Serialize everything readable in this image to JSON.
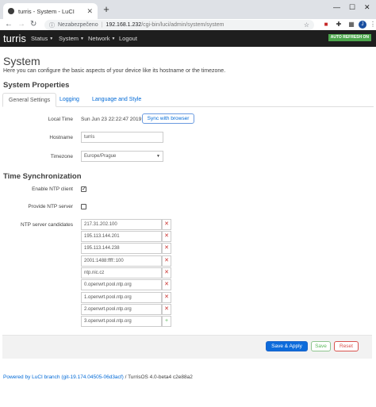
{
  "browser": {
    "tab_title": "turris - System - LuCI",
    "url_security": "Nezabezpečeno",
    "url_host": "192.168.1.232",
    "url_path": "/cgi-bin/luci/admin/system/system",
    "profile_initial": "J"
  },
  "luci": {
    "brand": "turris",
    "menu": [
      "Status",
      "System",
      "Network",
      "Logout"
    ],
    "auto_refresh": "AUTO REFRESH ON"
  },
  "page": {
    "title": "System",
    "description": "Here you can configure the basic aspects of your device like its hostname or the timezone."
  },
  "system_properties": {
    "heading": "System Properties",
    "tabs": [
      "General Settings",
      "Logging",
      "Language and Style"
    ],
    "local_time_label": "Local Time",
    "local_time_value": "Sun Jun 23 22:22:47 2019",
    "sync_button": "Sync with browser",
    "hostname_label": "Hostname",
    "hostname_value": "turris",
    "timezone_label": "Timezone",
    "timezone_value": "Europe/Prague"
  },
  "time_sync": {
    "heading": "Time Synchronization",
    "enable_ntp_label": "Enable NTP client",
    "enable_ntp_checked": true,
    "provide_ntp_label": "Provide NTP server",
    "provide_ntp_checked": false,
    "candidates_label": "NTP server candidates",
    "candidates": [
      "217.31.202.100",
      "195.113.144.201",
      "195.113.144.238",
      "2001:1488:ffff::100",
      "ntp.nic.cz",
      "0.openwrt.pool.ntp.org",
      "1.openwrt.pool.ntp.org",
      "2.openwrt.pool.ntp.org",
      "3.openwrt.pool.ntp.org"
    ]
  },
  "actions": {
    "apply": "Save & Apply",
    "save": "Save",
    "reset": "Reset"
  },
  "footer": {
    "link_text": "Powered by LuCI branch (git-19.174.04505-06d3acf)",
    "version": "/ TurrisOS 4.0-beta4 c2e88a2"
  }
}
